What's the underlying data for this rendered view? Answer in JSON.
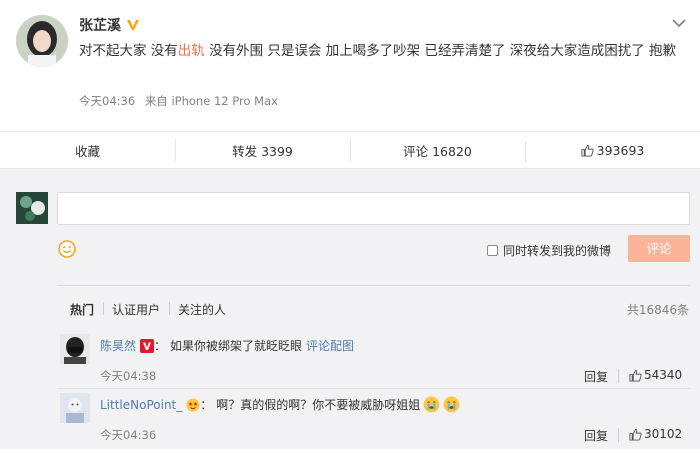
{
  "post": {
    "author": "张芷溪",
    "text_part1": "对不起大家 没有",
    "text_highlight": "出轨",
    "text_part2": " 没有外围 只是误会 加上喝多了吵架 已经弄清楚了 深夜给大家造成困扰了 抱歉",
    "time": "今天04:36",
    "source": "来自 iPhone 12 Pro Max"
  },
  "actions": {
    "favorite": "收藏",
    "repost": "转发 3399",
    "comment": "评论 16820",
    "like": "393693"
  },
  "composer": {
    "input_value": "",
    "repost_checkbox_label": "同时转发到我的微博",
    "submit_label": "评论"
  },
  "filters": {
    "hot": "热门",
    "verified": "认证用户",
    "following": "关注的人",
    "total": "共16846条"
  },
  "comments": [
    {
      "user": "陈昊然",
      "colon": "：",
      "text": "如果你被绑架了就眨眨眼",
      "link": "评论配图",
      "time": "今天04:38",
      "reply": "回复",
      "likes": "54340"
    },
    {
      "user": "LittleNoPoint_",
      "colon": "：",
      "text": "啊？真的假的啊？你不要被威胁呀姐姐",
      "time": "今天04:36",
      "reply": "回复",
      "likes": "30102"
    }
  ],
  "colors": {
    "accent": "#eb7350",
    "link": "#507daf",
    "submit_bg": "#fbb497",
    "vip": "#ffa500"
  }
}
